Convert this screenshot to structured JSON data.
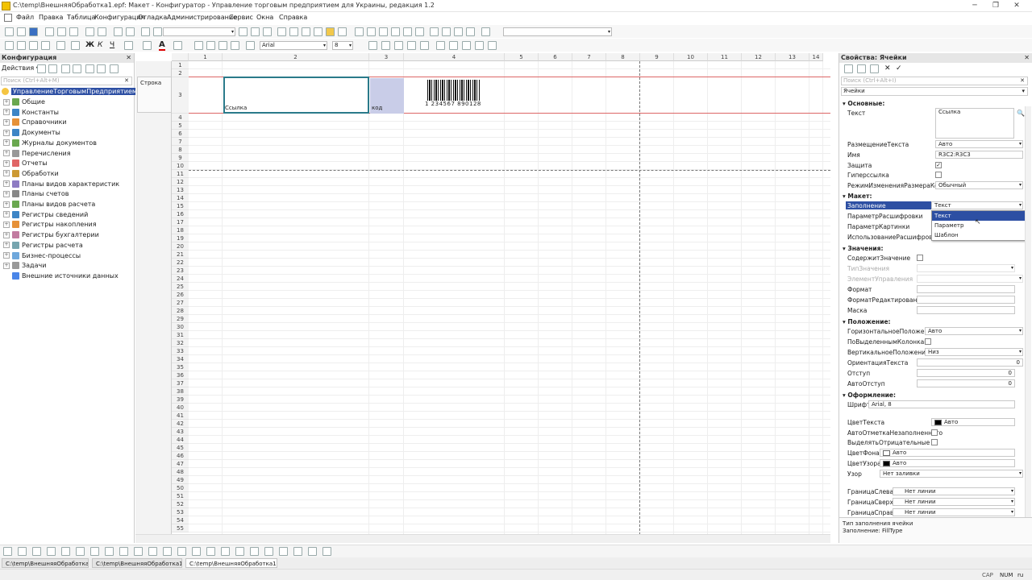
{
  "window": {
    "title": "C:\\temp\\ВнешняяОбработка1.epf: Макет - Конфигуратор - Управление торговым предприятием для Украины, редакция 1.2"
  },
  "menu": [
    "Файл",
    "Правка",
    "Таблица",
    "Конфигурация",
    "Отладка",
    "Администрирование",
    "Сервис",
    "Окна",
    "Справка"
  ],
  "toolbar": {
    "font_name": "Arial",
    "font_size": "8"
  },
  "config_panel": {
    "title": "Конфигурация",
    "actions_label": "Действия",
    "search_placeholder": "Поиск (Ctrl+Alt+M)",
    "root": "УправлениеТорговымПредприятием",
    "items": [
      "Общие",
      "Константы",
      "Справочники",
      "Документы",
      "Журналы документов",
      "Перечисления",
      "Отчеты",
      "Обработки",
      "Планы видов характеристик",
      "Планы счетов",
      "Планы видов расчета",
      "Регистры сведений",
      "Регистры накопления",
      "Регистры бухгалтерии",
      "Регистры расчета",
      "Бизнес-процессы",
      "Задачи",
      "Внешние источники данных"
    ]
  },
  "sheet": {
    "columns": [
      "1",
      "2",
      "3",
      "4",
      "5",
      "6",
      "7",
      "8",
      "9",
      "10",
      "11",
      "12",
      "13",
      "14"
    ],
    "rows": [
      "1",
      "2",
      "3",
      "4",
      "5",
      "6",
      "7",
      "8",
      "9",
      "10",
      "11",
      "12",
      "13",
      "14",
      "15",
      "16",
      "17",
      "18",
      "19",
      "20",
      "21",
      "22",
      "23",
      "24",
      "25",
      "26",
      "27",
      "28",
      "29",
      "30",
      "31",
      "32",
      "33",
      "34",
      "35",
      "36",
      "37",
      "38",
      "39",
      "40",
      "41",
      "42",
      "43",
      "44",
      "45",
      "46",
      "47",
      "48",
      "49",
      "50",
      "51",
      "52",
      "53",
      "54",
      "55"
    ],
    "area_name": "Строка",
    "cell_link": "Ссылка",
    "cell_code": "код",
    "barcode_text": "1 234567 890128"
  },
  "properties": {
    "title": "Свойства: Ячейки",
    "search_placeholder": "Поиск (Ctrl+Alt+I)",
    "object": "Ячейки",
    "sections": {
      "basic": "Основные:",
      "layout": "Макет:",
      "values": "Значения:",
      "position": "Положение:",
      "appearance": "Оформление:"
    },
    "labels": {
      "text": "Текст",
      "text_placement": "РазмещениеТекста",
      "name": "Имя",
      "protection": "Защита",
      "hyperlink": "Гиперссылка",
      "resize_mode": "РежимИзмененияРазмераКолонки",
      "fill": "Заполнение",
      "decode_param": "ПараметрРасшифровки",
      "pic_param": "ПараметрКартинки",
      "use_decode": "ИспользованиеРасшифровки",
      "contains_value": "СодержитЗначение",
      "value_type": "ТипЗначения",
      "control": "ЭлементУправления",
      "format": "Формат",
      "edit_format": "ФорматРедактирования",
      "mask": "Маска",
      "h_pos": "ГоризонтальноеПоложение",
      "by_selected": "ПоВыделеннымКолонкам",
      "v_pos": "ВертикальноеПоложение",
      "orientation": "ОриентацияТекста",
      "indent": "Отступ",
      "auto_indent": "АвтоОтступ",
      "font": "Шрифт",
      "text_color": "ЦветТекста",
      "auto_mark": "АвтоОтметкаНезаполненного",
      "highlight_neg": "ВыделятьОтрицательные",
      "bg_color": "ЦветФона",
      "pattern_color": "ЦветУзора",
      "pattern": "Узор",
      "border_left": "ГраницаСлева",
      "border_top": "ГраницаСверху",
      "border_right": "ГраницаСправа"
    },
    "values": {
      "text": "Ссылка",
      "text_placement": "Авто",
      "name": "R3C2:R3C3",
      "resize_mode": "Обычный",
      "fill": "Текст",
      "h_pos": "Авто",
      "v_pos": "Низ",
      "orientation": "0",
      "indent": "0",
      "auto_indent": "0",
      "font": "Arial, 8",
      "text_color": "Авто",
      "bg_color": "Авто",
      "pattern_color": "Авто",
      "pattern": "Нет заливки",
      "border_left": "Нет линии",
      "border_top": "Нет линии",
      "border_right": "Нет линии"
    },
    "fill_options": [
      "Текст",
      "Параметр",
      "Шаблон"
    ],
    "help_title": "Тип заполнения ячейки",
    "help_text": "Заполнение: FillType"
  },
  "taskbar": [
    "C:\\temp\\ВнешняяОбработка1.epf",
    "C:\\temp\\ВнешняяОбработка1.epf",
    "C:\\temp\\ВнешняяОбработка1.epf"
  ],
  "status": {
    "cap": "CAP",
    "num": "NUM",
    "lang": "ru"
  },
  "colors": {
    "selection": "#2d4fa3",
    "header_blue": "#1b5fb5",
    "accent_red": "#d04040"
  }
}
